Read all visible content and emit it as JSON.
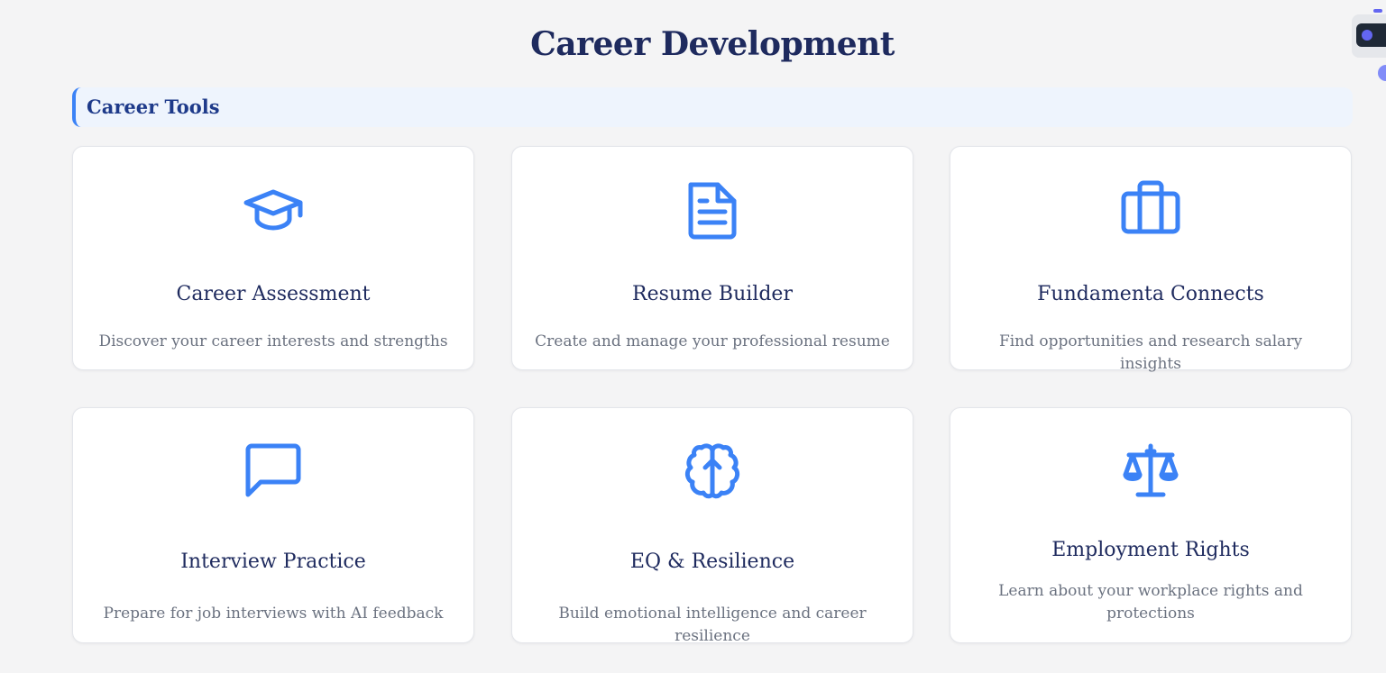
{
  "page": {
    "title": "Career Development"
  },
  "section": {
    "title": "Career Tools"
  },
  "colors": {
    "accent": "#3b82f6",
    "title": "#1e2a5e",
    "section_bg": "#eef4fd",
    "description": "#6b7280"
  },
  "cards": [
    {
      "icon": "graduation-cap-icon",
      "title": "Career Assessment",
      "description": "Discover your career interests and strengths"
    },
    {
      "icon": "document-icon",
      "title": "Resume Builder",
      "description": "Create and manage your professional resume"
    },
    {
      "icon": "briefcase-icon",
      "title": "Fundamenta Connects",
      "description": "Find opportunities and research salary insights"
    },
    {
      "icon": "chat-bubble-icon",
      "title": "Interview Practice",
      "description": "Prepare for job interviews with AI feedback"
    },
    {
      "icon": "brain-icon",
      "title": "EQ & Resilience",
      "description": "Build emotional intelligence and career resilience"
    },
    {
      "icon": "scales-icon",
      "title": "Employment Rights",
      "description": "Learn about your workplace rights and protections"
    }
  ]
}
